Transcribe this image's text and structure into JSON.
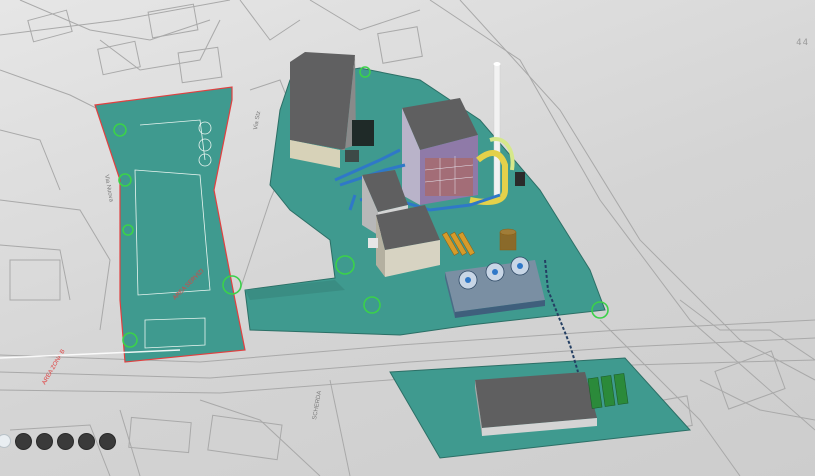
{
  "viewer": {
    "coordinate_label": "44",
    "nav_step_count": 6,
    "active_step": 1
  },
  "map_labels": {
    "street_north": "Via Stz",
    "street_mid": "Via Nuova",
    "street_south": "SCHERDA",
    "red_label_left": "AREA ZONA B",
    "red_label_center": "AREA SERVIZI"
  },
  "colors": {
    "site_teal": "#3f9a8f",
    "roof_gray": "#5f5f60",
    "boundary_red": "#e04040",
    "vegetation_green": "#3bd14a",
    "pipe_blue": "#2f78c8"
  }
}
